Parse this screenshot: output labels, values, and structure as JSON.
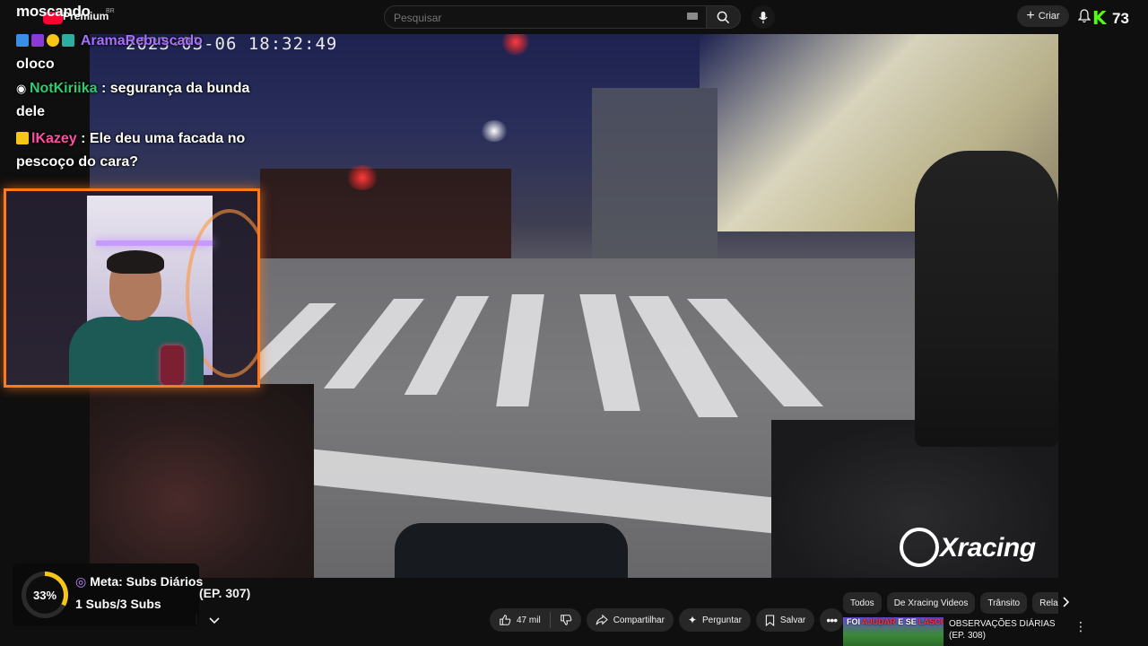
{
  "header": {
    "logo_text": "moscando",
    "logo_sub": "Premium",
    "logo_region": "BR",
    "search_placeholder": "Pesquisar",
    "create_label": "Criar",
    "kick_logo": "K",
    "kick_count": "73"
  },
  "overlay_chat": [
    {
      "user": "AramaRebuscado",
      "message": "oloco",
      "color": "#a970ff"
    },
    {
      "user": "NotKiriika",
      "message": "segurança da bunda dele",
      "color": "#2ecc71"
    },
    {
      "user": "lKazey",
      "message": "Ele deu uma facada no pescoço do cara?",
      "color": "#ff4fa0"
    }
  ],
  "video": {
    "timestamp": "2023-03-06  18:32:49",
    "watermark": "Xracing",
    "title_fragment": "(EP. 307)"
  },
  "sub_goal": {
    "percent_label": "33%",
    "percent_value": 0.33,
    "title": "Meta: Subs Diários",
    "count": "1 Subs/3 Subs",
    "accent_color": "#f5c518"
  },
  "actions": {
    "like_count": "47 mil",
    "share_label": "Compartilhar",
    "ask_label": "Perguntar",
    "save_label": "Salvar"
  },
  "chips": [
    "Todos",
    "De Xracing Videos",
    "Trânsito",
    "Relac"
  ],
  "recommended": [
    {
      "thumb_text_white": "FOI ",
      "thumb_text_red": "AJUDAR",
      "thumb_text_white2": " E SE ",
      "thumb_text_red2": "LASCOU",
      "title": "OBSERVAÇÕES DIÁRIAS (EP. 308)"
    }
  ]
}
